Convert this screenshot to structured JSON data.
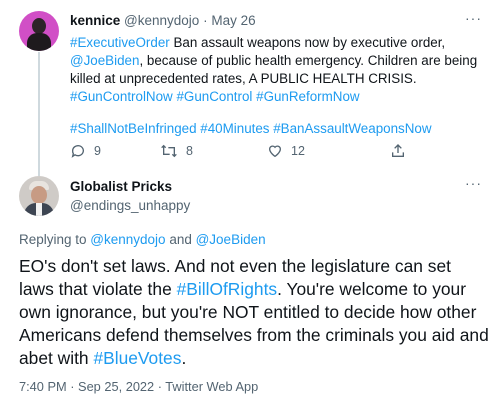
{
  "parent_tweet": {
    "name": "kennice",
    "handle": "@kennydojo",
    "sep": "·",
    "date": "May 26",
    "text_parts": [
      {
        "text": "#ExecutiveOrder",
        "link": true
      },
      {
        "text": " Ban assault weapons now by executive order, ",
        "link": false
      },
      {
        "text": "@JoeBiden",
        "link": true
      },
      {
        "text": ", because of public health emergency. Children are being killed at unprecedented rates, A PUBLIC HEALTH CRISIS. ",
        "link": false
      },
      {
        "text": "#GunControlNow",
        "link": true
      },
      {
        "text": " ",
        "link": false
      },
      {
        "text": "#GunControl",
        "link": true
      },
      {
        "text": " ",
        "link": false
      },
      {
        "text": "#GunReformNow",
        "link": true
      }
    ],
    "hashtags_line": "#ShallNotBeInfringed #40Minutes #BanAssaultWeaponsNow",
    "reply_count": "9",
    "retweet_count": "8",
    "like_count": "12",
    "more_label": "···"
  },
  "reply_tweet": {
    "name": "Globalist Pricks",
    "handle": "@endings_unhappy",
    "more_label": "···",
    "replying_prefix": "Replying to ",
    "replying_to_1": "@kennydojo",
    "replying_and": " and ",
    "replying_to_2": "@JoeBiden",
    "text_parts": [
      {
        "text": "EO's don't set laws.  And not even the legislature can set laws that violate the ",
        "link": false
      },
      {
        "text": "#BillOfRights",
        "link": true
      },
      {
        "text": ".  You're welcome to your own ignorance, but you're NOT entitled to decide how other Americans defend themselves from the criminals you aid and abet with ",
        "link": false
      },
      {
        "text": "#BlueVotes",
        "link": true
      },
      {
        "text": ".",
        "link": false
      }
    ],
    "timestamp": "7:40 PM · Sep 25, 2022 · Twitter Web App"
  },
  "colors": {
    "link": "#1d9bf0",
    "muted": "#536471",
    "text": "#0f1419"
  },
  "icons": {
    "reply": "reply-icon",
    "retweet": "retweet-icon",
    "like": "heart-icon",
    "share": "share-icon",
    "more": "more-icon"
  }
}
